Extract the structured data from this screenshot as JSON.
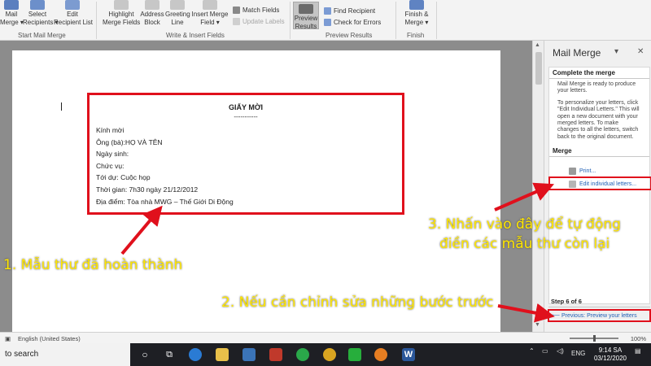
{
  "ribbon": {
    "start_group": {
      "label": "Start Mail Merge",
      "buttons": [
        "Mail\nMerge ▾",
        "Select\nRecipients ▾",
        "Edit\nRecipient List"
      ]
    },
    "write_group": {
      "label": "Write & Insert Fields",
      "buttons": [
        "Highlight\nMerge Fields",
        "Address\nBlock",
        "Greeting\nLine",
        "Insert Merge\nField ▾"
      ],
      "small": [
        "Match Fields",
        "Update Labels"
      ]
    },
    "preview_group": {
      "label": "Preview Results",
      "preview_button": "Preview\nResults",
      "small": [
        "Find Recipient",
        "Check for Errors"
      ]
    },
    "finish_group": {
      "label": "Finish",
      "button": "Finish &\nMerge ▾"
    }
  },
  "letter": {
    "title": "GIẤY MỜI",
    "dashes": "-----------",
    "lines": [
      "Kính mời",
      "Ông (bà):HỌ VÀ TÊN",
      "Ngày sinh:",
      "Chức vụ:",
      "Tới dự: Cuộc họp",
      "Thời gian: 7h30 ngày 21/12/2012",
      "Địa điểm: Tòa nhà MWG – Thế Giới Di Động"
    ]
  },
  "pane": {
    "title": "Mail Merge",
    "section_complete": "Complete the merge",
    "para1": "Mail Merge is ready to produce your letters.",
    "para2": "To personalize your letters, click \"Edit Individual Letters.\" This will open a new document with your merged letters. To make changes to all the letters, switch back to the original document.",
    "section_merge": "Merge",
    "print_link": "Print...",
    "edit_link": "Edit individual letters...",
    "step": "Step 6 of 6",
    "prev_link": "Previous: Preview your letters"
  },
  "annotations": {
    "a1": "1. Mẫu thư đã hoàn thành",
    "a2": "2. Nếu cần chỉnh sửa những bước trước",
    "a3_line1": "3. Nhấn vào đây để tự động",
    "a3_line2": "điền các mẫu thư còn lại"
  },
  "status": {
    "language": "English (United States)",
    "zoom": "100%"
  },
  "taskbar": {
    "search": "to search",
    "lang": "ENG",
    "time": "9:14 SA",
    "date": "03/12/2020"
  },
  "colors": {
    "annotation_yellow": "#ffe600",
    "highlight_red": "#e0101c",
    "link_blue": "#1f5fb5"
  }
}
